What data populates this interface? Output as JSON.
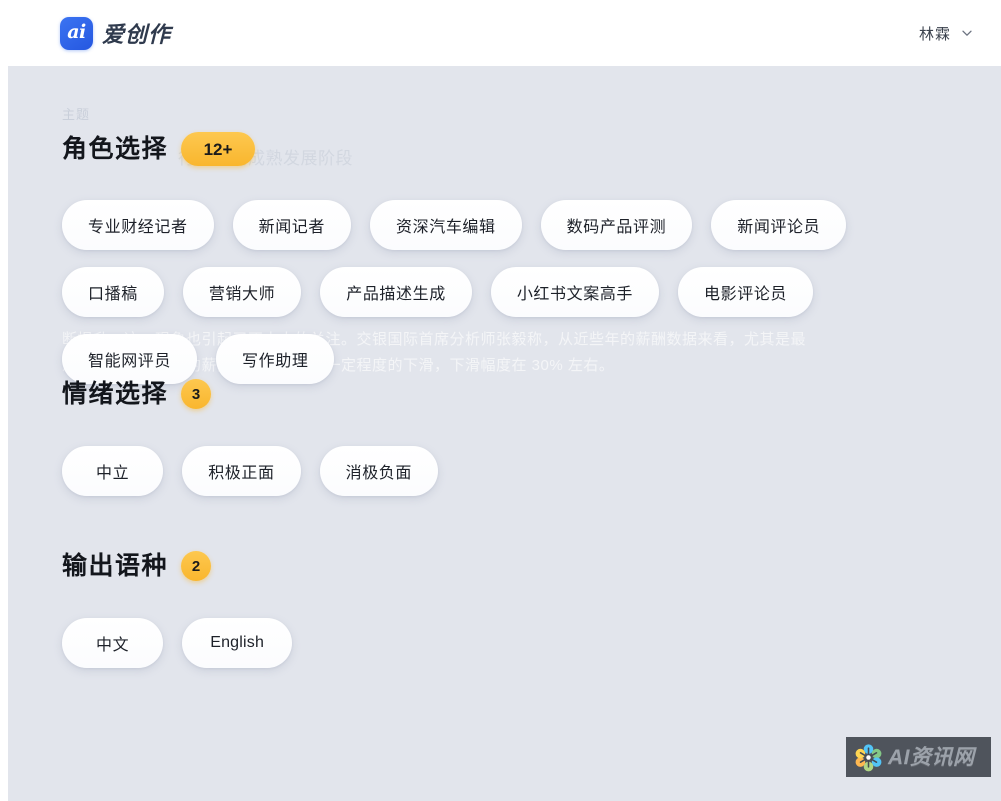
{
  "header": {
    "brand_mark": "ai",
    "brand_name": "爱创作",
    "user_name": "林霖",
    "chevron_icon": "chevron-down-icon"
  },
  "background": {
    "label": "主题",
    "ghost_lines": [
      "行业走向成熟发展阶段",
      "断提升，这一现象也引起了不少人的关注。交银国际首席分析师张毅称，从近些年的薪酬数据来看，尤其是最",
      "近一段时间，主播的薪资总体来说呈现一定程度的下滑，下滑幅度在 30% 左右。"
    ]
  },
  "sections": [
    {
      "id": "role-selection",
      "title": "角色选择",
      "badge": "12+",
      "badge_shape": "wide",
      "chips": [
        "专业财经记者",
        "新闻记者",
        "资深汽车编辑",
        "数码产品评测",
        "新闻评论员",
        "口播稿",
        "营销大师",
        "产品描述生成",
        "小红书文案高手",
        "电影评论员",
        "智能网评员",
        "写作助理"
      ]
    },
    {
      "id": "emotion-selection",
      "title": "情绪选择",
      "badge": "3",
      "badge_shape": "round",
      "chips": [
        "中立",
        "积极正面",
        "消极负面"
      ]
    },
    {
      "id": "language-selection",
      "title": "输出语种",
      "badge": "2",
      "badge_shape": "round",
      "chips": [
        "中文",
        "English"
      ]
    }
  ],
  "watermark": {
    "text": "AI资讯网",
    "logo_icon": "flower-petal-logo-icon"
  },
  "colors": {
    "accent_blue": "#2563eb",
    "badge_orange": "#fbbf3c",
    "page_bg": "#e2e5ec",
    "chip_bg": "#ffffff",
    "text_dark": "#13161c"
  }
}
